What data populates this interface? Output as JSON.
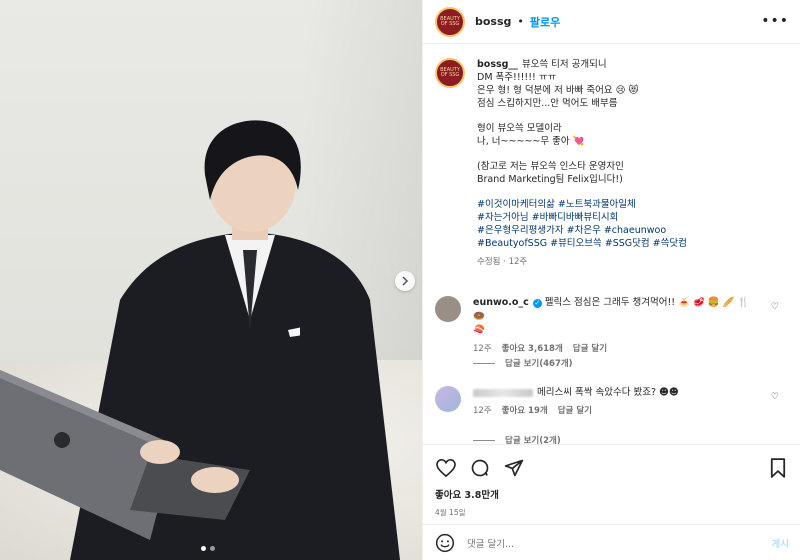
{
  "post_header": {
    "username": "bossg",
    "separator": "•",
    "follow_label": "팔로우",
    "more_label": "•••"
  },
  "avatar_logo_text": "BEAUTY OF SSG",
  "caption": {
    "username": "bossg__",
    "lines": [
      "뷰오쓱 티저 공개되니",
      "DM 폭주!!!!!! ㅠㅠ",
      "은우 형! 형 덕분에 저 바빠 죽어요 😢 😻",
      "점심 스킵하지만...안 먹어도 배부름"
    ],
    "para2": [
      "형이 뷰오쓱 모델이라",
      "나, 너~~~~~무 좋아 💘"
    ],
    "para3": [
      "(참고로 저는 뷰오쓱 인스타 운영자인",
      "Brand Marketing팀 Felix입니다!)"
    ],
    "hashtags": [
      "#이것이마케터의삶 #노트북과물아일체",
      "#자는거아님 #바빠디바빠뷰티시회",
      "#은우형우리평생가자 #차은우 #chaeunwoo",
      "#BeautyofSSG #뷰티오브쓱 #SSG닷컴 #쓱닷컴"
    ],
    "meta": "수정됨 · 12주"
  },
  "comments": [
    {
      "username": "eunwo.o_c",
      "verified": true,
      "text": "펠릭스 점심은 그래두 챙겨먹어!! 🍝 🥩 🍔 🥖 🍴 🍩",
      "text2": "🍣",
      "age": "12주",
      "likes": "좋아요 3,618개",
      "reply": "답글 달기",
      "view_replies": "답글 보기(467개)"
    },
    {
      "username": "",
      "text": "메리스씨 폭싹 속았수다 봤죠? ☻☻",
      "age": "12주",
      "likes": "좋아요 19개",
      "reply": "답글 달기",
      "view_replies": "답글 보기(2개)"
    }
  ],
  "actions": {
    "likes": "좋아요 3.8만개",
    "date": "4월 15일"
  },
  "add_comment": {
    "placeholder": "댓글 달기...",
    "post_label": "게시"
  }
}
